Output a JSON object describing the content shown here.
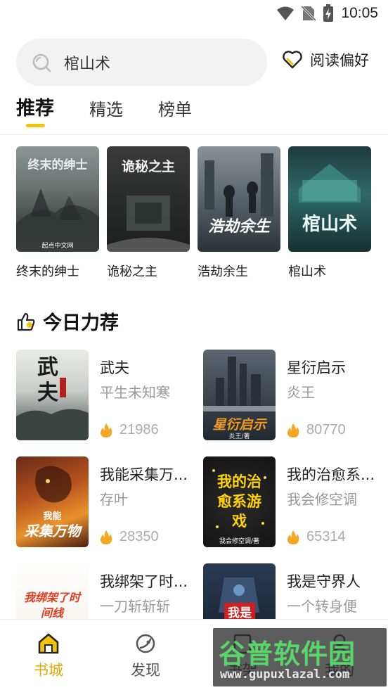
{
  "status_bar": {
    "time": "10:05",
    "icons": [
      "wifi-icon",
      "no-sim-icon",
      "battery-charging-icon"
    ]
  },
  "search": {
    "text": "棺山术",
    "icon": "search-icon"
  },
  "reading_pref": {
    "label": "阅读偏好",
    "icon": "heart-icon"
  },
  "tabs": [
    {
      "label": "推荐",
      "active": true
    },
    {
      "label": "精选",
      "active": false
    },
    {
      "label": "榜单",
      "active": false
    }
  ],
  "featured": [
    {
      "title": "终末的绅士",
      "cover_text": "终末的绅士",
      "cover_sub": "起点中文网"
    },
    {
      "title": "诡秘之主",
      "cover_text": "诡秘之主",
      "cover_sub": ""
    },
    {
      "title": "浩劫余生",
      "cover_text": "浩劫余生",
      "cover_sub": ""
    },
    {
      "title": "棺山术",
      "cover_text": "棺山术",
      "cover_sub": ""
    }
  ],
  "section": {
    "title": "今日力荐",
    "icon": "thumbs-up-icon"
  },
  "books": [
    {
      "title": "武夫",
      "author": "平生未知寒",
      "heat": "21986",
      "cover_text": "武夫"
    },
    {
      "title": "星衍启示",
      "author": "炎王",
      "heat": "80770",
      "cover_text": "星衍启示",
      "cover_sub": "炎王/著"
    },
    {
      "title": "我能采集万...",
      "author": "存叶",
      "heat": "28350",
      "cover_text": "采集万物",
      "cover_sub": "我能"
    },
    {
      "title": "我的治愈系...",
      "author": "我会修空调",
      "heat": "65314",
      "cover_text": "我的治愈系游戏",
      "cover_sub": "我会修空调/著"
    },
    {
      "title": "我绑架了时...",
      "author": "一刀斩斩斩",
      "heat": "",
      "cover_text": "我绑架了时间线"
    },
    {
      "title": "我是守界人",
      "author": "一个转身便",
      "heat": "",
      "cover_text": "我是"
    }
  ],
  "bottom_nav": [
    {
      "label": "书城",
      "icon": "home-icon",
      "active": true
    },
    {
      "label": "发现",
      "icon": "discover-icon",
      "active": false
    },
    {
      "label": "书架",
      "icon": "bookshelf-icon",
      "active": false
    },
    {
      "label": "我的",
      "icon": "user-icon",
      "active": false
    }
  ],
  "watermark": {
    "brand": "谷普软件园",
    "url": "www.gupuxlazal.com"
  },
  "colors": {
    "accent": "#f5c20a",
    "nav_active": "#e7a800",
    "flame": "#f5a623"
  }
}
